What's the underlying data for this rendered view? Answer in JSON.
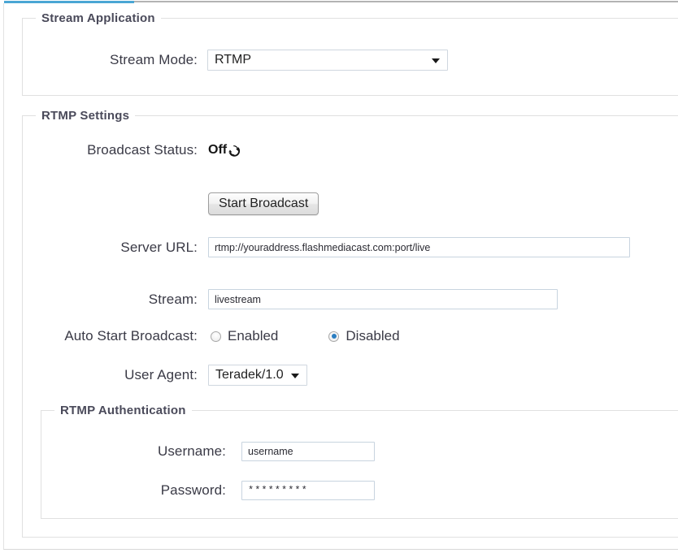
{
  "theme": {
    "accent": "#4aa6d4",
    "radio_selected": "#2b7ec1",
    "legend_text": "#4a4a5a",
    "label_text": "#3a3a46",
    "input_border": "#c8d4df",
    "fieldset_border": "#e0e0e0"
  },
  "stream_application": {
    "legend": "Stream Application",
    "stream_mode": {
      "label": "Stream Mode:",
      "value": "RTMP",
      "arrow_icon": "chevron-down-icon"
    }
  },
  "rtmp_settings": {
    "legend": "RTMP Settings",
    "broadcast_status": {
      "label": "Broadcast Status:",
      "value": "Off",
      "refresh_icon": "refresh-icon"
    },
    "start_broadcast_button": "Start Broadcast",
    "server_url": {
      "label": "Server URL:",
      "value": "rtmp://youraddress.flashmediacast.com:port/live",
      "placeholder": "rtmp://youraddress.flashmediacast.com:port/live"
    },
    "stream": {
      "label": "Stream:",
      "value": "livestream",
      "placeholder": "livestream"
    },
    "auto_start_broadcast": {
      "label": "Auto Start Broadcast:",
      "options": [
        {
          "label": "Enabled",
          "selected": false
        },
        {
          "label": "Disabled",
          "selected": true
        }
      ]
    },
    "user_agent": {
      "label": "User Agent:",
      "value": "Teradek/1.0",
      "arrow_icon": "chevron-down-icon"
    }
  },
  "rtmp_authentication": {
    "legend": "RTMP Authentication",
    "username": {
      "label": "Username:",
      "value": "username",
      "placeholder": "username"
    },
    "password": {
      "label": "Password:",
      "value": "*********",
      "placeholder": "*********"
    }
  }
}
